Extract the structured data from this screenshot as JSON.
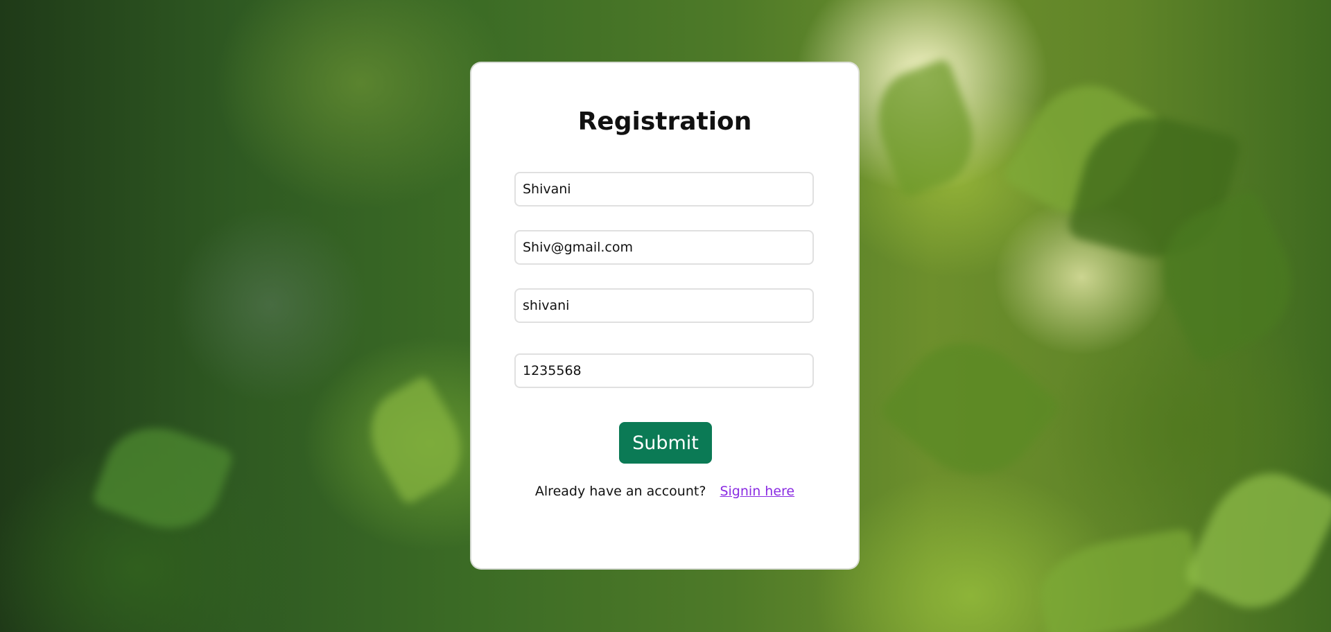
{
  "form": {
    "title": "Registration",
    "fields": [
      {
        "value": "Shivani"
      },
      {
        "value": "Shiv@gmail.com"
      },
      {
        "value": "shivani"
      },
      {
        "value": "1235568"
      }
    ],
    "submit_label": "Submit",
    "account_prompt": "Already have an account?",
    "signin_label": "Signin here"
  },
  "colors": {
    "submit_bg": "#0b7a55",
    "link": "#8a2be2"
  }
}
